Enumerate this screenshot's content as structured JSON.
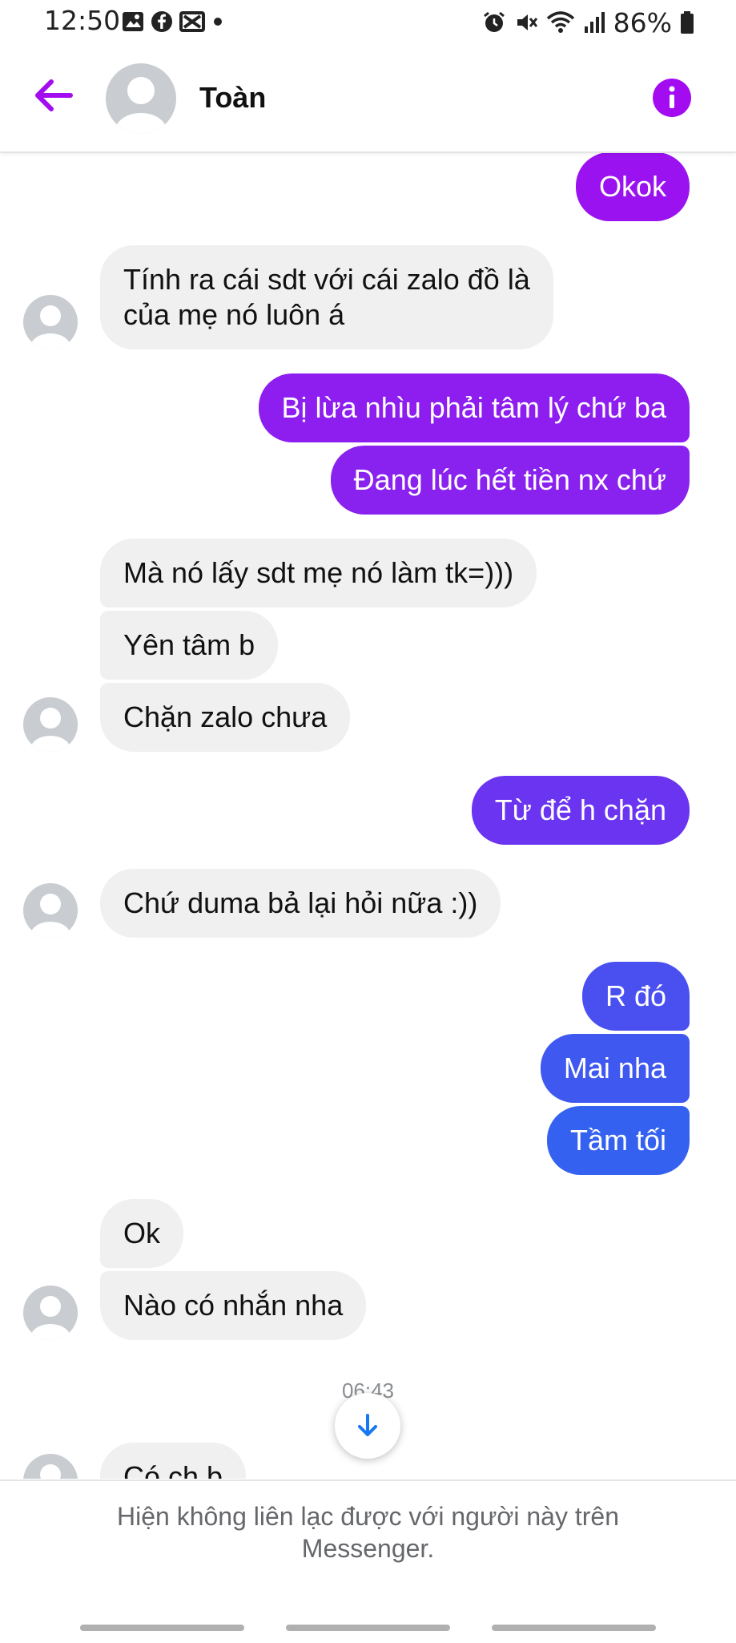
{
  "status_bar": {
    "time": "12:50",
    "battery": "86%",
    "left_icons": [
      "gallery-icon",
      "facebook-icon",
      "capcut-icon",
      "dot-icon"
    ],
    "right_icons": [
      "alarm-icon",
      "mute-icon",
      "wifi-icon",
      "signal-icon",
      "battery-icon"
    ]
  },
  "header": {
    "contact_name": "Toàn",
    "accent": "#a30cf0"
  },
  "messages": [
    {
      "text": "Okok",
      "dir": "out",
      "color": "#9a12ef"
    },
    {
      "text": "Tính ra cái sdt với cái zalo đồ là",
      "dir": "in"
    },
    {
      "text": "của mẹ nó luôn á",
      "dir": "in"
    },
    {
      "text": "Bị lừa nhìu phải tâm lý chứ ba",
      "dir": "out",
      "color": "#8e1ef0"
    },
    {
      "text": "Đang lúc hết tiền nx chứ",
      "dir": "out",
      "color": "#8a22ef"
    },
    {
      "text": "Mà nó lấy sdt mẹ nó làm tk=)))",
      "dir": "in"
    },
    {
      "text": "Yên tâm b",
      "dir": "in"
    },
    {
      "text": "Chặn zalo chưa",
      "dir": "in"
    },
    {
      "text": "Từ để h chặn",
      "dir": "out",
      "color": "#6a34f0"
    },
    {
      "text": "Chứ duma bả lại hỏi nữa :))",
      "dir": "in"
    },
    {
      "text": "R đó",
      "dir": "out",
      "color": "#4a50f0"
    },
    {
      "text": "Mai nha",
      "dir": "out",
      "color": "#3f58ef"
    },
    {
      "text": "Tầm tối",
      "dir": "out",
      "color": "#3461ef"
    },
    {
      "text": "Ok",
      "dir": "in"
    },
    {
      "text": "Nào có nhắn nha",
      "dir": "in"
    },
    {
      "text": "Có ch b",
      "dir": "in"
    }
  ],
  "timestamp": "06:43",
  "footer": {
    "note": "Hiện không liên lạc được với người này trên Messenger."
  }
}
